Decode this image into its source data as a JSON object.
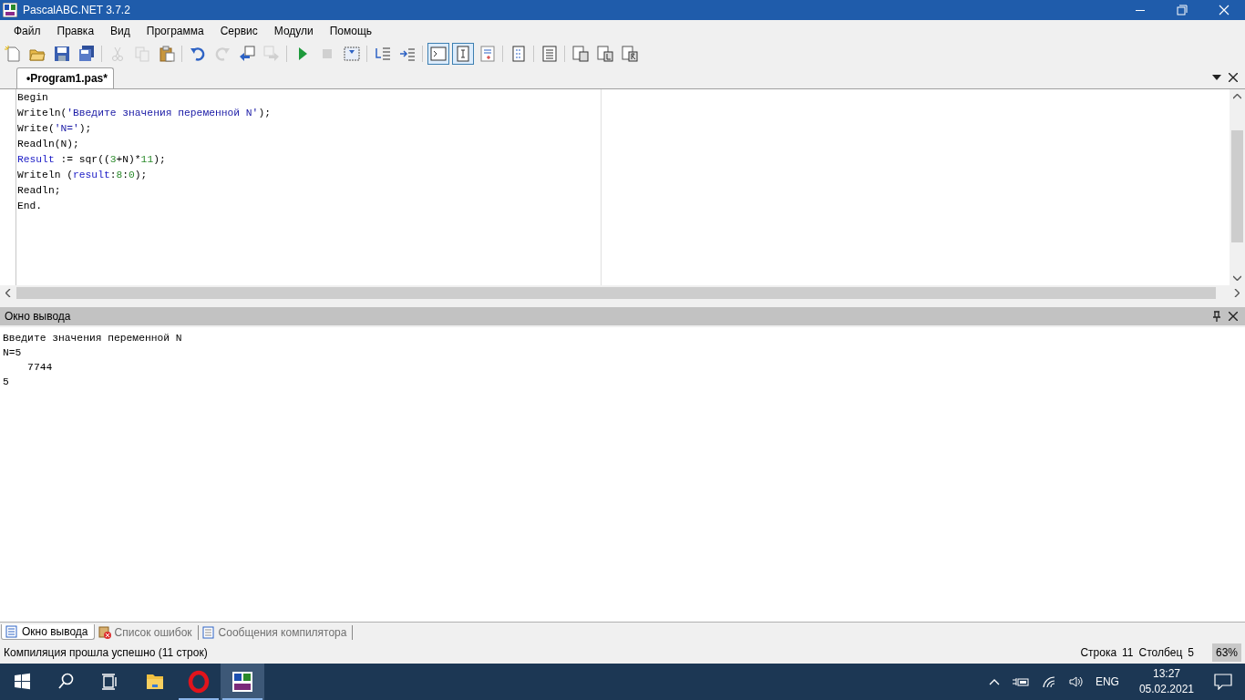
{
  "window": {
    "title": "PascalABC.NET 3.7.2"
  },
  "menu": [
    "Файл",
    "Правка",
    "Вид",
    "Программа",
    "Сервис",
    "Модули",
    "Помощь"
  ],
  "toolbar": [
    {
      "kind": "button",
      "disabled": false,
      "pressed": false
    },
    {
      "kind": "button",
      "disabled": false,
      "pressed": false
    },
    {
      "kind": "button",
      "disabled": false,
      "pressed": false
    },
    {
      "kind": "button",
      "disabled": false,
      "pressed": false
    },
    {
      "kind": "separator"
    },
    {
      "kind": "button",
      "disabled": true,
      "pressed": false
    },
    {
      "kind": "button",
      "disabled": true,
      "pressed": false
    },
    {
      "kind": "button",
      "disabled": false,
      "pressed": false
    },
    {
      "kind": "separator"
    },
    {
      "kind": "button",
      "disabled": false,
      "pressed": false
    },
    {
      "kind": "button",
      "disabled": true,
      "pressed": false
    },
    {
      "kind": "button",
      "disabled": false,
      "pressed": false
    },
    {
      "kind": "button",
      "disabled": true,
      "pressed": false
    },
    {
      "kind": "separator"
    },
    {
      "kind": "button",
      "disabled": false,
      "pressed": false
    },
    {
      "kind": "button",
      "disabled": true,
      "pressed": false
    },
    {
      "kind": "button",
      "disabled": false,
      "pressed": false
    },
    {
      "kind": "separator"
    },
    {
      "kind": "button",
      "disabled": false,
      "pressed": false
    },
    {
      "kind": "button",
      "disabled": false,
      "pressed": false
    },
    {
      "kind": "separator"
    },
    {
      "kind": "button",
      "disabled": false,
      "pressed": true
    },
    {
      "kind": "button",
      "disabled": false,
      "pressed": true
    },
    {
      "kind": "button",
      "disabled": false,
      "pressed": false
    },
    {
      "kind": "separator"
    },
    {
      "kind": "button",
      "disabled": false,
      "pressed": false
    },
    {
      "kind": "separator"
    },
    {
      "kind": "button",
      "disabled": false,
      "pressed": false
    },
    {
      "kind": "separator"
    },
    {
      "kind": "button",
      "disabled": false,
      "pressed": false
    },
    {
      "kind": "button",
      "disabled": false,
      "pressed": false
    },
    {
      "kind": "button",
      "disabled": false,
      "pressed": false
    }
  ],
  "editor_tabs": [
    {
      "label": "•Program1.pas*",
      "selected": true
    }
  ],
  "code": [
    [
      {
        "kind": "plain",
        "text": "Begin"
      }
    ],
    [
      {
        "kind": "plain",
        "text": "Writeln("
      },
      {
        "kind": "string",
        "text": "'Введите значения переменной N'"
      },
      {
        "kind": "plain",
        "text": ");"
      }
    ],
    [
      {
        "kind": "plain",
        "text": "Write("
      },
      {
        "kind": "string",
        "text": "'N='"
      },
      {
        "kind": "plain",
        "text": ");"
      }
    ],
    [
      {
        "kind": "plain",
        "text": "Readln(N);"
      }
    ],
    [
      {
        "kind": "ident",
        "text": "Result"
      },
      {
        "kind": "plain",
        "text": " := sqr(("
      },
      {
        "kind": "number",
        "text": "3"
      },
      {
        "kind": "plain",
        "text": "+N)*"
      },
      {
        "kind": "number",
        "text": "11"
      },
      {
        "kind": "plain",
        "text": ");"
      }
    ],
    [
      {
        "kind": "plain",
        "text": "Writeln ("
      },
      {
        "kind": "ident",
        "text": "result"
      },
      {
        "kind": "plain",
        "text": ":"
      },
      {
        "kind": "number",
        "text": "8"
      },
      {
        "kind": "plain",
        "text": ":"
      },
      {
        "kind": "number",
        "text": "0"
      },
      {
        "kind": "plain",
        "text": ");"
      }
    ],
    [
      {
        "kind": "plain",
        "text": "Readln;"
      }
    ],
    [
      {
        "kind": "plain",
        "text": "End."
      }
    ]
  ],
  "output": {
    "title": "Окно вывода",
    "lines": [
      "Введите значения переменной N",
      "N=5",
      "    7744",
      "5"
    ]
  },
  "bottom_tabs": [
    {
      "label": "Окно вывода",
      "selected": true
    },
    {
      "label": "Список ошибок",
      "selected": false
    },
    {
      "label": "Сообщения компилятора",
      "selected": false
    }
  ],
  "status_bar": {
    "message": "Компиляция прошла успешно (11 строк)",
    "line_label": "Строка",
    "line": "11",
    "col_label": "Столбец",
    "col": "5",
    "zoom": "63%"
  },
  "taskbar": {
    "apps": [
      {
        "running": false,
        "active": false
      },
      {
        "running": true,
        "active": false
      },
      {
        "running": true,
        "active": true
      }
    ],
    "language": "ENG",
    "time": "13:27",
    "date": "05.02.2021"
  }
}
